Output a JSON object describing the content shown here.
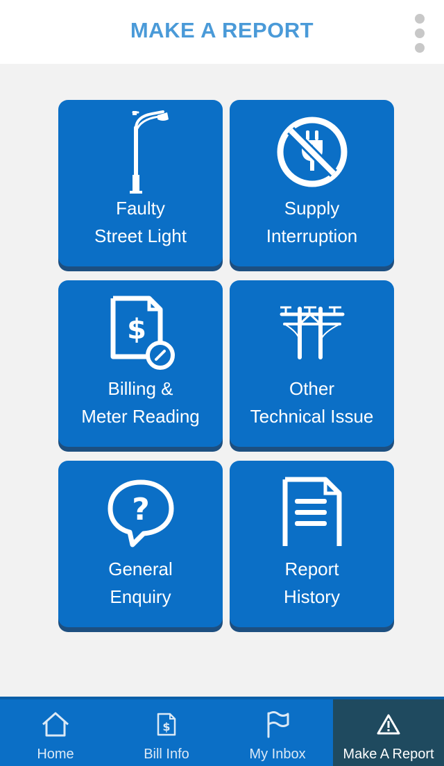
{
  "header": {
    "title": "MAKE A REPORT"
  },
  "tiles": [
    {
      "line1": "Faulty",
      "line2": "Street Light",
      "icon": "street-light-icon"
    },
    {
      "line1": "Supply",
      "line2": "Interruption",
      "icon": "no-power-plug-icon"
    },
    {
      "line1": "Billing &",
      "line2": "Meter Reading",
      "icon": "bill-meter-icon"
    },
    {
      "line1": "Other",
      "line2": "Technical Issue",
      "icon": "power-pylon-icon"
    },
    {
      "line1": "General",
      "line2": "Enquiry",
      "icon": "question-bubble-icon"
    },
    {
      "line1": "Report",
      "line2": "History",
      "icon": "document-icon"
    }
  ],
  "nav": {
    "items": [
      {
        "label": "Home",
        "icon": "home-icon"
      },
      {
        "label": "Bill Info",
        "icon": "bill-icon"
      },
      {
        "label": "My Inbox",
        "icon": "flag-icon"
      },
      {
        "label": "Make A Report",
        "icon": "warning-icon",
        "active": true
      }
    ]
  },
  "colors": {
    "tile": "#0b6fc6",
    "tile_shadow": "#1d4f80",
    "header_title": "#4a9ad8",
    "nav_active": "#1f4a5f"
  }
}
